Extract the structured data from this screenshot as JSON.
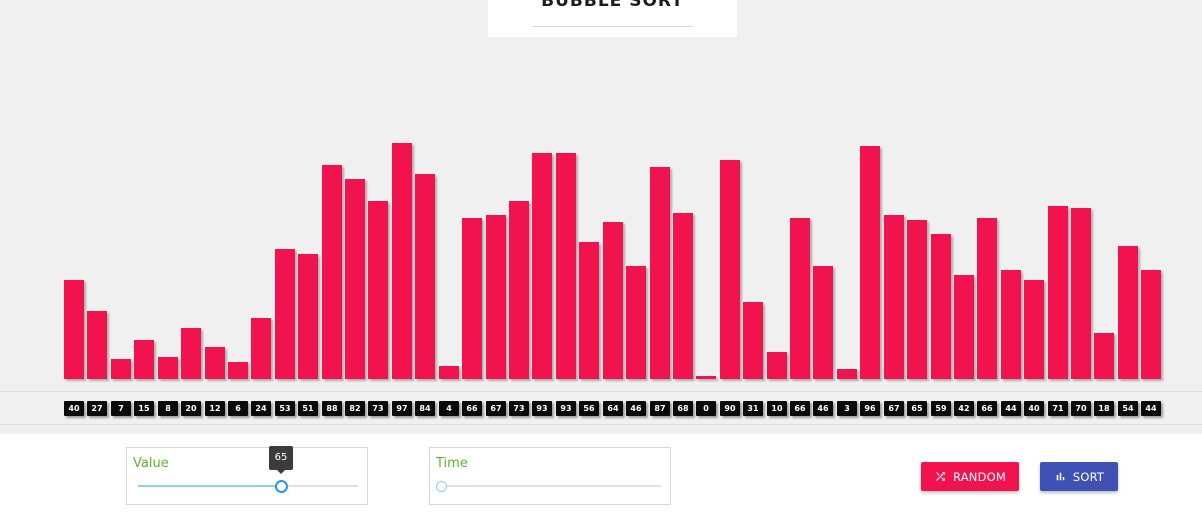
{
  "header": {
    "title": "BUBBLE SORT"
  },
  "array": {
    "values": [
      40,
      27,
      7,
      15,
      8,
      20,
      12,
      6,
      24,
      53,
      51,
      88,
      82,
      73,
      97,
      84,
      4,
      66,
      67,
      73,
      93,
      93,
      56,
      64,
      46,
      87,
      68,
      0,
      90,
      31,
      10,
      66,
      46,
      3,
      96,
      67,
      65,
      59,
      42,
      66,
      44,
      40,
      71,
      70,
      18,
      54,
      44
    ],
    "bar_color": "#f0134d",
    "label_color": "#0a0a0a"
  },
  "controls": {
    "value_slider": {
      "label": "Value",
      "value": 65,
      "tooltip": "65",
      "fraction": 0.65
    },
    "time_slider": {
      "label": "Time",
      "fraction": 0
    },
    "random_button": {
      "label": "RANDOM",
      "icon": "shuffle-icon",
      "color": "#f0134d"
    },
    "sort_button": {
      "label": "SORT",
      "icon": "bar-chart-icon",
      "color": "#3f51b5"
    }
  }
}
